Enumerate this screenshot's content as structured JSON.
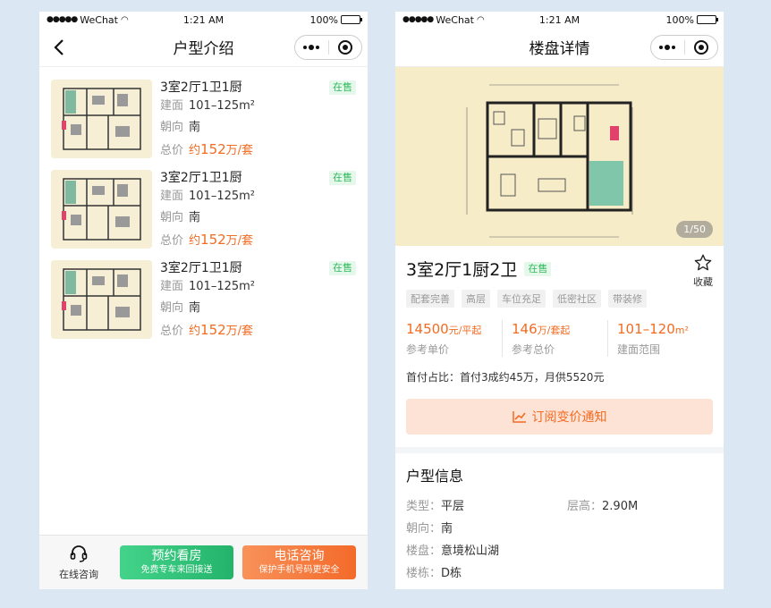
{
  "status": {
    "carrier": "WeChat",
    "time": "1:21 AM",
    "battery": "100%"
  },
  "left": {
    "nav_title": "户型介绍",
    "items": [
      {
        "title": "3室2厅1卫1厨",
        "badge": "在售",
        "area_label": "建面",
        "area_value": "101–125m²",
        "orient_label": "朝向",
        "orient_value": "南",
        "price_label": "总价",
        "price_prefix": "约",
        "price_num": "152",
        "price_unit": "万/套"
      },
      {
        "title": "3室2厅1卫1厨",
        "badge": "在售",
        "area_label": "建面",
        "area_value": "101–125m²",
        "orient_label": "朝向",
        "orient_value": "南",
        "price_label": "总价",
        "price_prefix": "约",
        "price_num": "152",
        "price_unit": "万/套"
      },
      {
        "title": "3室2厅1卫1厨",
        "badge": "在售",
        "area_label": "建面",
        "area_value": "101–125m²",
        "orient_label": "朝向",
        "orient_value": "南",
        "price_label": "总价",
        "price_prefix": "约",
        "price_num": "152",
        "price_unit": "万/套"
      }
    ],
    "bottom": {
      "online_label": "在线咨询",
      "book_main": "预约看房",
      "book_sub": "免费专车来回接送",
      "call_main": "电话咨询",
      "call_sub": "保护手机号码更安全"
    }
  },
  "right": {
    "nav_title": "楼盘详情",
    "image_counter": "1/50",
    "title": "3室2厅1厨2卫",
    "badge": "在售",
    "fav_label": "收藏",
    "tags": [
      "配套完善",
      "高层",
      "车位充足",
      "低密社区",
      "带装修"
    ],
    "stats": [
      {
        "num": "14500",
        "unit": "元/平起",
        "cap": "参考单价"
      },
      {
        "num": "146",
        "unit": "万/套起",
        "cap": "参考总价"
      },
      {
        "num": "101–120",
        "unit": "m²",
        "cap": "建面范围"
      }
    ],
    "down_payment": "首付占比：首付3成约45万，月供5520元",
    "subscribe_label": "订阅变价通知",
    "section_title": "户型信息",
    "info": {
      "type_k": "类型：",
      "type_v": "平层",
      "height_k": "层高：",
      "height_v": "2.90M",
      "orient_k": "朝向：",
      "orient_v": "南",
      "estate_k": "楼盘：",
      "estate_v": "意境松山湖",
      "building_k": "楼栋：",
      "building_v": "D栋"
    }
  },
  "colors": {
    "accent_orange": "#f26b21",
    "accent_green": "#2fbb5c",
    "bg": "#dbe8f4"
  }
}
